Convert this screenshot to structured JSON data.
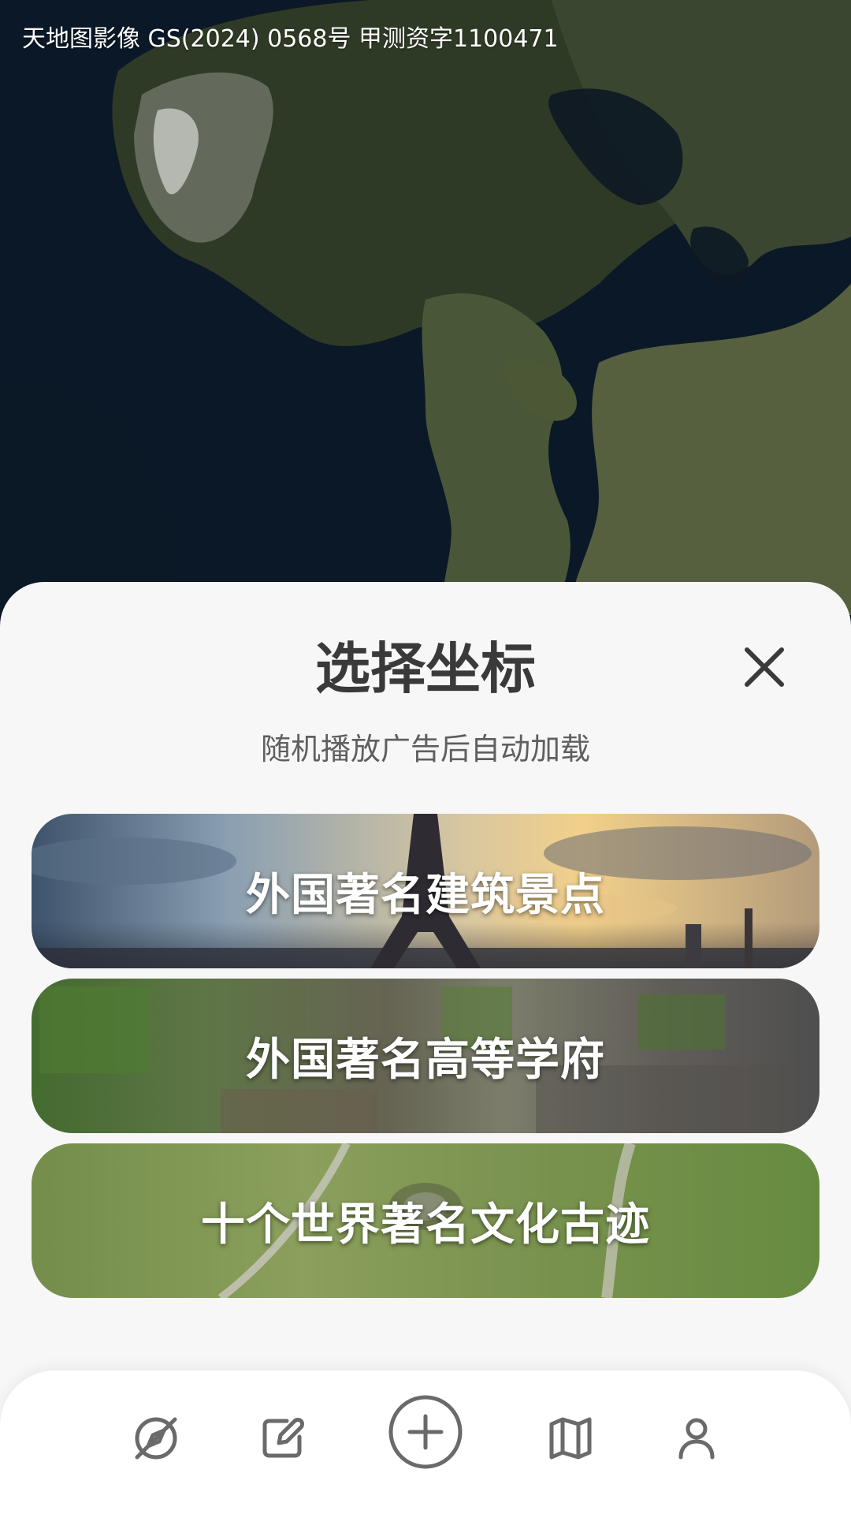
{
  "map": {
    "credit": "天地图影像 GS(2024) 0568号 甲测资字1100471"
  },
  "sheet": {
    "title": "选择坐标",
    "subtitle": "随机播放广告后自动加载",
    "close_icon": "close-icon"
  },
  "cards": [
    {
      "label": "外国著名建筑景点"
    },
    {
      "label": "外国著名高等学府"
    },
    {
      "label": "十个世界著名文化古迹"
    }
  ],
  "nav": {
    "icons": [
      "compass-off-icon",
      "edit-icon",
      "add-circle-icon",
      "map-icon",
      "user-icon"
    ]
  },
  "colors": {
    "sheet_bg": "#f7f7f7",
    "title_text": "#3a3a3a",
    "subtitle_text": "#5f5f5f",
    "icon": "#6a6a6a"
  }
}
